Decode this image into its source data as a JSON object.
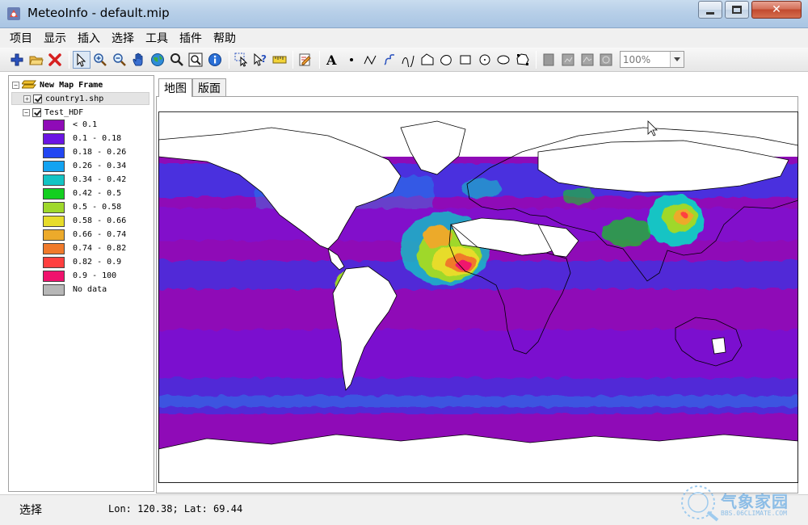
{
  "window": {
    "title": "MeteoInfo - default.mip",
    "close_glyph": "✕"
  },
  "menu": [
    "项目",
    "显示",
    "插入",
    "选择",
    "工具",
    "插件",
    "帮助"
  ],
  "toolbar": {
    "groups": [
      [
        "add-layer-icon",
        "open-folder-icon",
        "remove-layer-icon"
      ],
      [
        "select-pointer-icon",
        "zoom-in-icon",
        "zoom-out-icon",
        "pan-hand-icon",
        "globe-full-extent-icon",
        "magnifier-icon",
        "zoom-to-layer-icon",
        "identify-info-icon"
      ],
      [
        "select-features-icon",
        "help-query-icon",
        "measure-icon"
      ],
      [
        "edit-icon"
      ],
      [
        "text-icon",
        "point-icon",
        "polyline-icon",
        "freehand-icon",
        "curve-icon",
        "polygon-icon",
        "curve-polygon-icon",
        "rectangle-icon",
        "circle-icon",
        "ellipse-icon",
        "freehand-polygon-icon"
      ],
      [
        "layout-page-icon",
        "layout-grid-1-icon",
        "layout-grid-2-icon",
        "layout-grid-3-icon"
      ]
    ],
    "zoom_value": "100%"
  },
  "legend": {
    "map_frame": "New Map Frame",
    "layers": [
      {
        "name": "country1.shp",
        "expander": "+",
        "checked": true
      },
      {
        "name": "Test_HDF",
        "expander": "−",
        "checked": true
      }
    ],
    "breaks": [
      {
        "label": "< 0.1",
        "color": "#8f0bb7"
      },
      {
        "label": "0.1 - 0.18",
        "color": "#6b15e3"
      },
      {
        "label": "0.18 - 0.26",
        "color": "#2246f2"
      },
      {
        "label": "0.26 - 0.34",
        "color": "#13a3f1"
      },
      {
        "label": "0.34 - 0.42",
        "color": "#13c4c4"
      },
      {
        "label": "0.42 - 0.5",
        "color": "#13cf20"
      },
      {
        "label": "0.5 - 0.58",
        "color": "#9fd82b"
      },
      {
        "label": "0.58 - 0.66",
        "color": "#e7dc2b"
      },
      {
        "label": "0.66 - 0.74",
        "color": "#ecaa2b"
      },
      {
        "label": "0.74 - 0.82",
        "color": "#f07a2b"
      },
      {
        "label": "0.82 - 0.9",
        "color": "#ff3f3f"
      },
      {
        "label": "0.9 - 100",
        "color": "#f0126d"
      },
      {
        "label": "No data",
        "color": "#b7b7b7"
      }
    ]
  },
  "tabs": [
    {
      "label": "地图",
      "active": true
    },
    {
      "label": "版面",
      "active": false
    }
  ],
  "status": {
    "mode": "选择",
    "coords": "Lon: 120.38; Lat: 69.44"
  },
  "watermark": {
    "text": "气象家园",
    "sub": "BBS.06CLIMATE.COM"
  }
}
